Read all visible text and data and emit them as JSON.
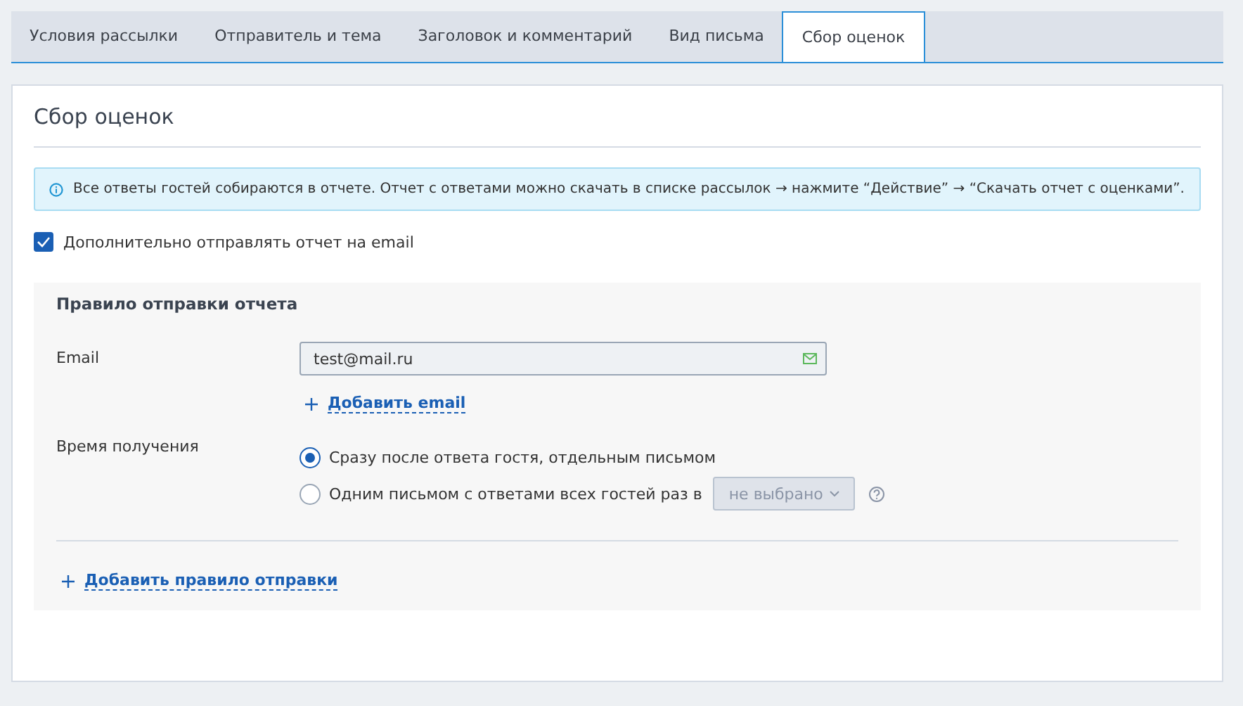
{
  "tabs": [
    {
      "label": "Условия рассылки",
      "selected": false
    },
    {
      "label": "Отправитель и тема",
      "selected": false
    },
    {
      "label": "Заголовок и комментарий",
      "selected": false
    },
    {
      "label": "Вид письма",
      "selected": false
    },
    {
      "label": "Сбор оценок",
      "selected": true
    }
  ],
  "heading": "Сбор оценок",
  "info": "Все ответы гостей собираются в отчете. Отчет с ответами можно скачать в списке рассылок → нажмите “Действие” → “Скачать отчет с оценками”.",
  "send_email": {
    "label": "Дополнительно отправлять отчет на email",
    "checked": true
  },
  "rule": {
    "title": "Правило отправки отчета",
    "email_label": "Email",
    "email_value": "test@mail.ru",
    "add_email": "Добавить email",
    "time_label": "Время получения",
    "options": [
      {
        "label": "Сразу после ответа гостя, отдельным письмом",
        "selected": true
      },
      {
        "label": "Одним письмом с ответами всех гостей раз в",
        "selected": false,
        "select": {
          "value": "не выбрано",
          "disabled": true
        }
      }
    ]
  },
  "add_rule": "Добавить правило отправки"
}
